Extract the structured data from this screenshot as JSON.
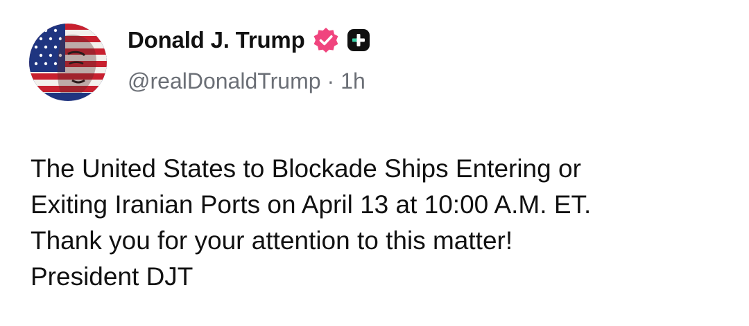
{
  "author": {
    "display_name": "Donald J. Trump",
    "handle": "@realDonaldTrump",
    "separator": "·",
    "time_ago": "1h",
    "avatar_icon": "flag-portrait-avatar",
    "verified_icon": "verified-badge-icon",
    "plus_icon": "plus-badge-icon"
  },
  "colors": {
    "verified": "#f0447e",
    "plus_badge": "#111111",
    "plus_accent": "#39d2a8",
    "handle_text": "#6b6f76",
    "body_text": "#111111"
  },
  "post": {
    "lines": [
      "The United States to Blockade Ships Entering or",
      "Exiting Iranian Ports on April 13 at 10:00 A.M. ET.",
      "Thank you for your attention to this matter!",
      "President DJT"
    ]
  }
}
